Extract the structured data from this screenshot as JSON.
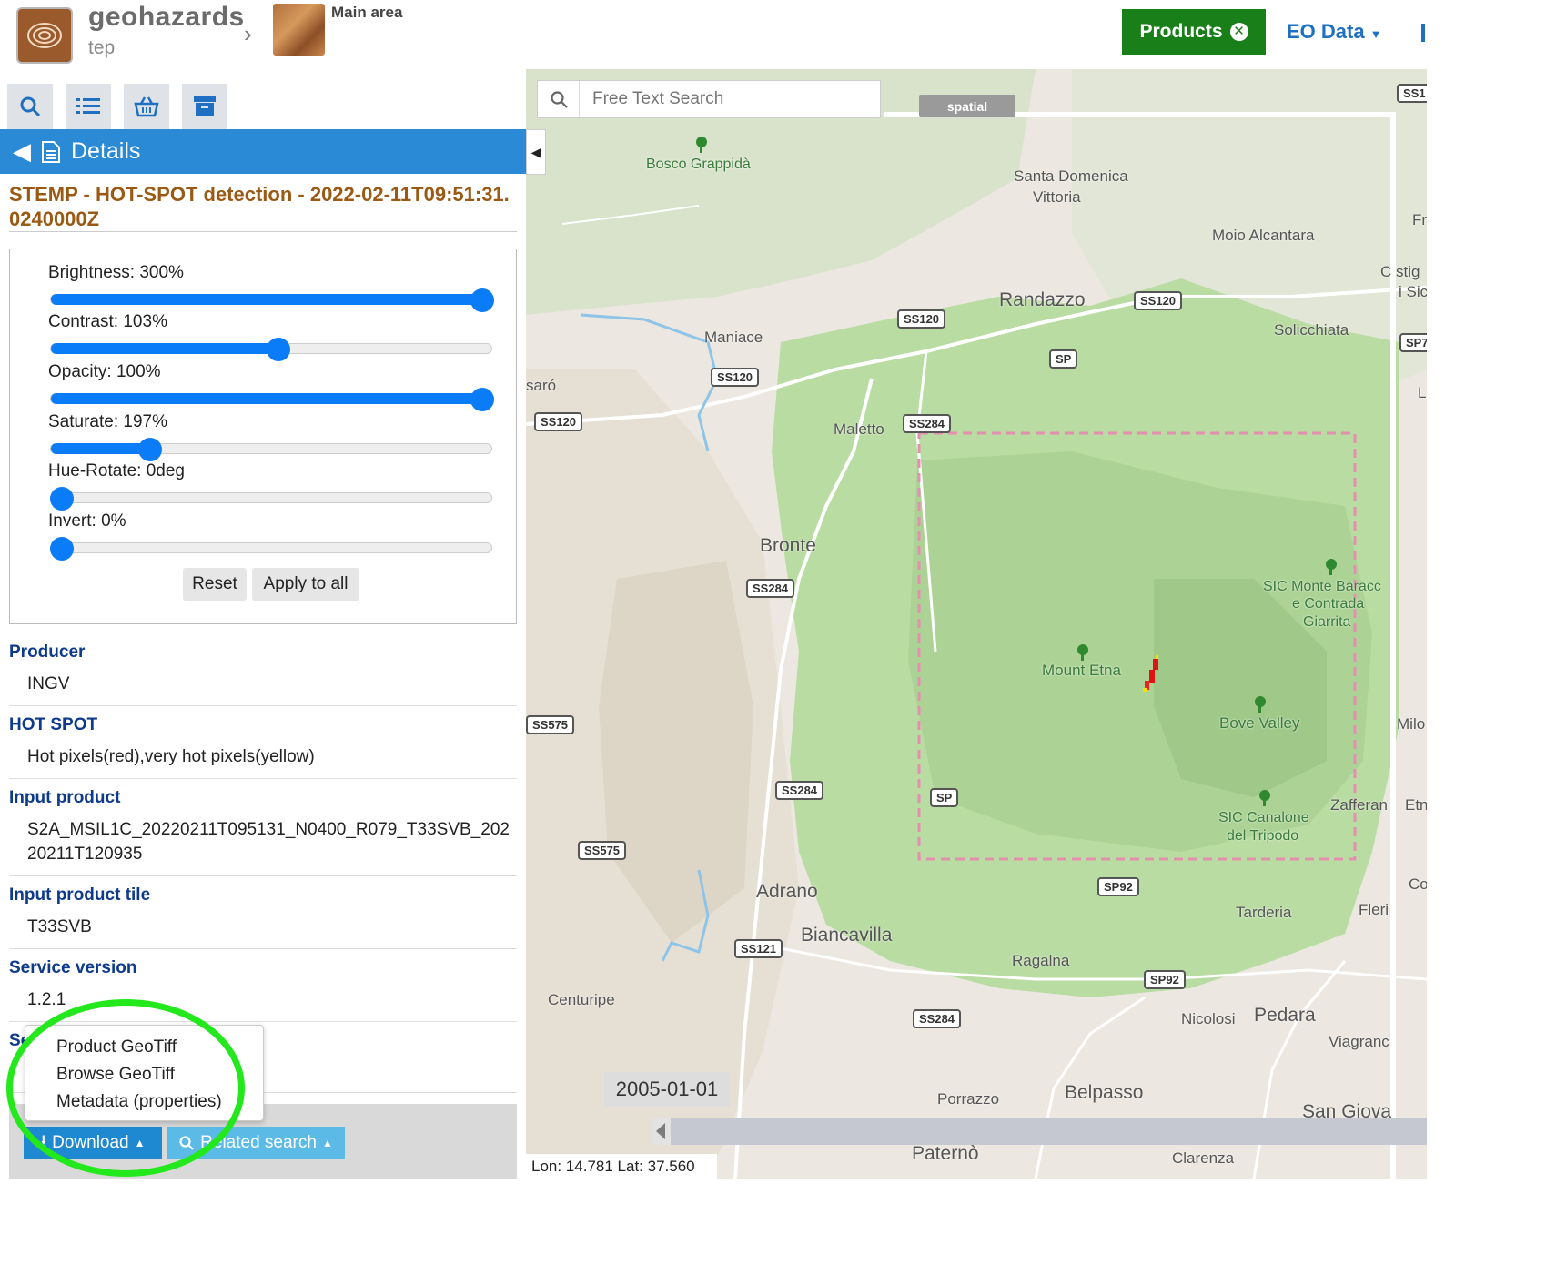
{
  "header": {
    "brand_name": "geohazards",
    "brand_sub": "tep",
    "area_label": "Main area",
    "products_label": "Products",
    "eo_data_label": "EO Data"
  },
  "details": {
    "header_label": "Details",
    "title": "STEMP - HOT-SPOT detection - 2022-02-11T09:51:31.0240000Z"
  },
  "filters": [
    {
      "label": "Brightness: 300%",
      "value": 1.0
    },
    {
      "label": "Contrast: 103%",
      "value": 0.515
    },
    {
      "label": "Opacity: 100%",
      "value": 1.0
    },
    {
      "label": "Saturate: 197%",
      "value": 0.21
    },
    {
      "label": "Hue-Rotate: 0deg",
      "value": 0.0
    },
    {
      "label": "Invert: 0%",
      "value": 0.0
    }
  ],
  "filter_buttons": {
    "reset": "Reset",
    "apply_all": "Apply to all"
  },
  "metadata": [
    {
      "key": "Producer",
      "value": "INGV"
    },
    {
      "key": "HOT SPOT",
      "value": "Hot pixels(red),very hot pixels(yellow)"
    },
    {
      "key": "Input product",
      "value": "S2A_MSIL1C_20220211T095131_N0400_R079_T33SVB_20220211T120935"
    },
    {
      "key": "Input product tile",
      "value": "T33SVB"
    },
    {
      "key": "Service version",
      "value": "1.2.1"
    },
    {
      "key": "Se",
      "value": ""
    }
  ],
  "download_menu": [
    "Product GeoTiff",
    "Browse GeoTiff",
    "Metadata (properties)"
  ],
  "footer": {
    "download_label": "Download",
    "related_label": "Related search"
  },
  "map": {
    "search_placeholder": "Free Text Search",
    "spatial_label": "spatial",
    "date_label": "2005-01-01",
    "coords": "Lon: 14.781 Lat: 37.560",
    "place_labels": [
      "Bosco Grappidà",
      "Santa Domenica",
      "Vittoria",
      "Moio Alcantara",
      "Randazzo",
      "Maniace",
      "Solicchiata",
      "Maletto",
      "Bronte",
      "Mount Etna",
      "SIC Monte Baracc",
      "e Contrada",
      "Giarrita",
      "Bove Valley",
      "Adrano",
      "Biancavilla",
      "Ragalna",
      "Tarderia",
      "Fleri",
      "Centuripe",
      "Nicolosi",
      "Pedara",
      "Viagranc",
      "Porrazzo",
      "Belpasso",
      "San Giova",
      "Paternò",
      "Clarenza",
      "Zafferan",
      "SIC Canalone",
      "del Tripodo",
      "saró",
      "Milo",
      "Fr",
      "C stig",
      "i Sic",
      "L",
      "Etn",
      "Co"
    ],
    "road_labels": [
      "SS120",
      "SS120",
      "SS120",
      "SS120",
      "SP",
      "SS284",
      "SS284",
      "SS284",
      "SS284",
      "SS575",
      "SS575",
      "SP",
      "SP92",
      "SP92",
      "SS121",
      "SP7",
      "SS1"
    ]
  },
  "colors": {
    "accent_blue": "#2b8ad6",
    "products_green": "#197f18",
    "title_brown": "#9b5a14",
    "meta_key_blue": "#0e3a8b",
    "highlight_green": "#23e81b",
    "slider_blue": "#0b7cf7",
    "aoi_pink": "#e58fb0"
  }
}
